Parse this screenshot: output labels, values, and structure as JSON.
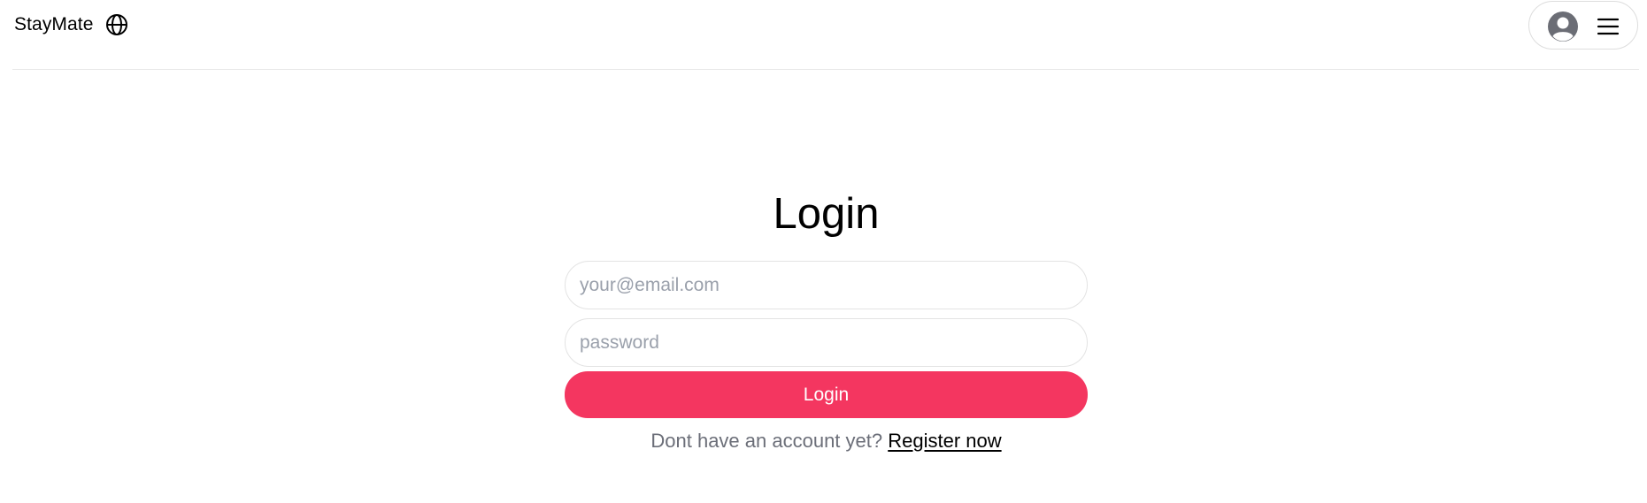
{
  "header": {
    "brand": "StayMate",
    "globe_icon": "globe-icon",
    "avatar_icon": "user-avatar-icon",
    "menu_icon": "hamburger-menu-icon"
  },
  "login": {
    "title": "Login",
    "email_placeholder": "your@email.com",
    "email_value": "",
    "password_placeholder": "password",
    "password_value": "",
    "submit_label": "Login",
    "register_prompt": "Dont have an account yet?",
    "register_link": "Register now"
  },
  "colors": {
    "primary": "#f43660",
    "muted_text": "#6b6e78",
    "placeholder": "#9aa0ab",
    "border": "#e3e3e3"
  }
}
